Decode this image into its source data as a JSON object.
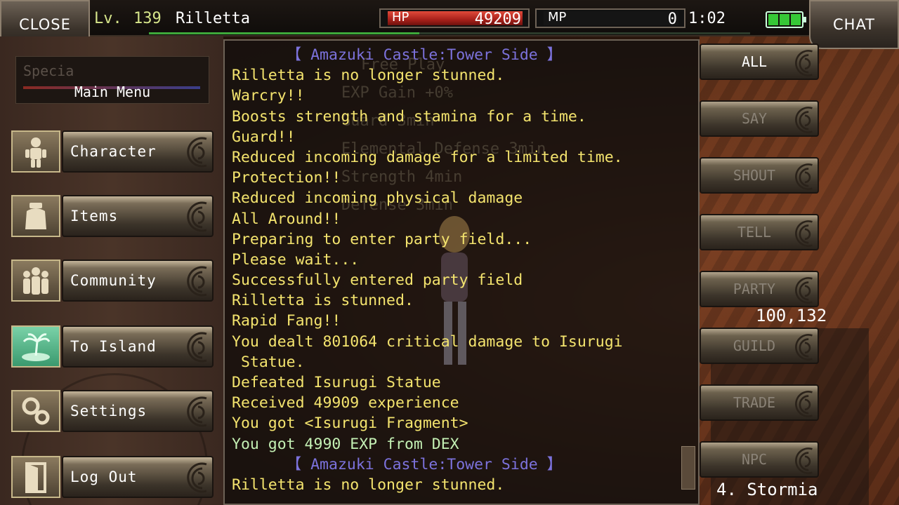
{
  "header": {
    "close_label": "CLOSE",
    "chat_label": "CHAT",
    "level_prefix": "Lv.",
    "level": "139",
    "player_name": "Rilletta",
    "hp_label": "HP",
    "hp_value": "49209",
    "mp_label": "MP",
    "mp_value": "0",
    "time": "1:02",
    "xp_fraction": 0.45
  },
  "sidebar": {
    "partial_text": "Specia",
    "main_menu_label": "Main Menu",
    "items": [
      {
        "label": "Character",
        "icon": "character-icon"
      },
      {
        "label": "Items",
        "icon": "items-icon"
      },
      {
        "label": "Community",
        "icon": "community-icon"
      },
      {
        "label": "To Island",
        "icon": "island-icon"
      },
      {
        "label": "Settings",
        "icon": "settings-icon"
      },
      {
        "label": "Log Out",
        "icon": "logout-icon"
      }
    ]
  },
  "background_text": [
    "Free Play",
    "EXP Gain +0%",
    "Guard 3min",
    "Elemental Defense 3min",
    "Strength 4min",
    "Defense 3min"
  ],
  "chat_log": [
    {
      "text": "      【 Amazuki Castle:Tower Side 】",
      "kind": "loc"
    },
    {
      "text": "Rilletta is no longer stunned.",
      "kind": "msg"
    },
    {
      "text": "Warcry!!",
      "kind": "msg"
    },
    {
      "text": "Boosts strength and stamina for a time.",
      "kind": "msg"
    },
    {
      "text": "Guard!!",
      "kind": "msg"
    },
    {
      "text": "Reduced incoming damage for a limited time.",
      "kind": "msg"
    },
    {
      "text": "Protection!!",
      "kind": "msg"
    },
    {
      "text": "Reduced incoming physical damage",
      "kind": "msg"
    },
    {
      "text": "All Around!!",
      "kind": "msg"
    },
    {
      "text": "Preparing to enter party field...",
      "kind": "msg"
    },
    {
      "text": "Please wait...",
      "kind": "msg"
    },
    {
      "text": "Successfully entered party field",
      "kind": "msg"
    },
    {
      "text": "Rilletta is stunned.",
      "kind": "msg"
    },
    {
      "text": "Rapid Fang!!",
      "kind": "msg"
    },
    {
      "text": "You dealt 801064 critical damage to Isurugi",
      "kind": "msg"
    },
    {
      "text": " Statue.",
      "kind": "msg"
    },
    {
      "text": "Defeated Isurugi Statue",
      "kind": "msg"
    },
    {
      "text": "Received 49909 experience",
      "kind": "msg"
    },
    {
      "text": "You got <Isurugi Fragment>",
      "kind": "msg"
    },
    {
      "text": "You got 4990 EXP from DEX",
      "kind": "exp"
    },
    {
      "text": "      【 Amazuki Castle:Tower Side 】",
      "kind": "loc"
    },
    {
      "text": "Rilletta is no longer stunned.",
      "kind": "msg"
    }
  ],
  "channels": [
    "ALL",
    "SAY",
    "SHOUT",
    "TELL",
    "PARTY",
    "GUILD",
    "TRADE",
    "NPC"
  ],
  "active_channel": "ALL",
  "coordinates": "100,132",
  "server": "4. Stormia",
  "colors": {
    "log_text": "#f4e46e",
    "log_location": "#7c72dc",
    "log_exp": "#c4f0b4",
    "hp_bar": "#c82a20",
    "battery": "#36c836"
  }
}
